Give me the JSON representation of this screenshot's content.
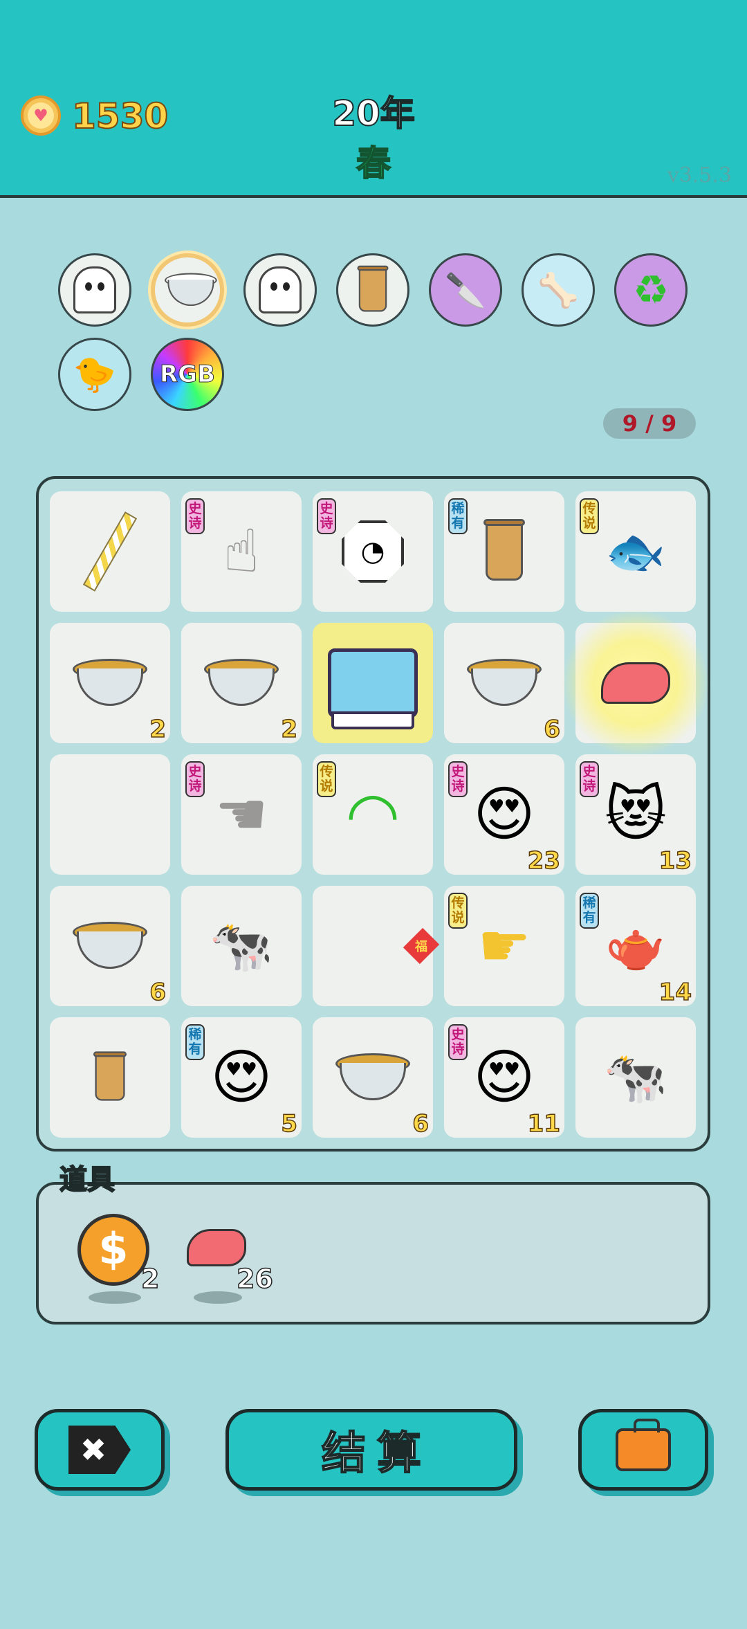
{
  "header": {
    "gold": "1530",
    "year": "20年",
    "season": "春",
    "version": "v3.5.3"
  },
  "symbols": [
    {
      "name": "ghost-icon"
    },
    {
      "name": "rice-bowl-icon",
      "selected": true
    },
    {
      "name": "ghost-icon"
    },
    {
      "name": "bubble-tea-icon"
    },
    {
      "name": "cleaver-icon"
    },
    {
      "name": "dog-food-icon"
    },
    {
      "name": "recycle-icon"
    },
    {
      "name": "chicken-syringe-icon"
    },
    {
      "name": "rgb-icon",
      "label": "RGB"
    }
  ],
  "counter": "9 / 9",
  "board": {
    "cells": [
      {
        "icon": "straw-icon",
        "tag": "",
        "count": ""
      },
      {
        "icon": "pointing-hand-icon",
        "tag": "史诗",
        "count": ""
      },
      {
        "icon": "bagua-icon",
        "tag": "史诗",
        "count": ""
      },
      {
        "icon": "bubble-tea-icon",
        "tag": "稀有",
        "count": ""
      },
      {
        "icon": "koi-fish-icon",
        "tag": "传说",
        "count": ""
      },
      {
        "icon": "soup-bowl-icon",
        "tag": "",
        "count": "2"
      },
      {
        "icon": "soup-bowl-icon",
        "tag": "",
        "count": "2"
      },
      {
        "icon": "computer-icon",
        "tag": "",
        "count": ""
      },
      {
        "icon": "soup-bowl-icon",
        "tag": "",
        "count": "6"
      },
      {
        "icon": "liver-icon",
        "tag": "",
        "count": ""
      },
      {
        "icon": "",
        "tag": "",
        "count": ""
      },
      {
        "icon": "pointing-hand-icon",
        "tag": "史诗",
        "count": ""
      },
      {
        "icon": "wifi-icon",
        "tag": "传说",
        "count": ""
      },
      {
        "icon": "heart-eyes-girl-icon",
        "tag": "史诗",
        "count": "23"
      },
      {
        "icon": "heart-eyes-emoji-icon",
        "tag": "史诗",
        "count": "13"
      },
      {
        "icon": "soup-bowl-icon",
        "tag": "",
        "count": "6"
      },
      {
        "icon": "cow-icon",
        "tag": "",
        "count": ""
      },
      {
        "icon": "fu-icon",
        "tag": "",
        "count": ""
      },
      {
        "icon": "pointing-hand-icon",
        "tag": "传说",
        "count": ""
      },
      {
        "icon": "teapot-icon",
        "tag": "稀有",
        "count": "14"
      },
      {
        "icon": "bubble-tea-icon",
        "tag": "",
        "count": ""
      },
      {
        "icon": "heart-eyes-man-icon",
        "tag": "稀有",
        "count": "5"
      },
      {
        "icon": "soup-bowl-icon",
        "tag": "",
        "count": "6"
      },
      {
        "icon": "heart-eyes-girl-icon",
        "tag": "史诗",
        "count": "11"
      },
      {
        "icon": "cow-icon",
        "tag": "",
        "count": ""
      }
    ]
  },
  "tools": {
    "label": "道具",
    "items": [
      {
        "icon": "coin-icon",
        "symbol": "$",
        "count": "2"
      },
      {
        "icon": "liver-icon",
        "count": "26"
      }
    ]
  },
  "buttons": {
    "skip_icon": "✖",
    "settle": "结算",
    "bag_icon": "briefcase-icon"
  },
  "colors": {
    "accent": "#25c4c3",
    "background": "#a8dade",
    "gold": "#ffd44a"
  }
}
